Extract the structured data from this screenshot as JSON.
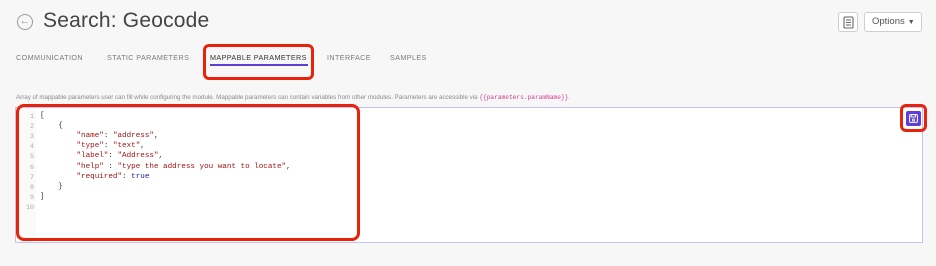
{
  "header": {
    "title": "Search: Geocode",
    "options_label": "Options"
  },
  "tabs": [
    {
      "label": "COMMUNICATION"
    },
    {
      "label": "STATIC PARAMETERS"
    },
    {
      "label": "MAPPABLE PARAMETERS"
    },
    {
      "label": "INTERFACE"
    },
    {
      "label": "SAMPLES"
    }
  ],
  "active_tab": "MAPPABLE PARAMETERS",
  "description": {
    "text": "Array of mappable parameters user can fill while configuring the module. Mappable parameters can contain variables from other modules. Parameters are accessible via ",
    "code_ref": "{{parameters.paramName}}",
    "suffix": "."
  },
  "editor": {
    "line_numbers": [
      "1",
      "2",
      "3",
      "4",
      "5",
      "6",
      "7",
      "8",
      "9",
      "10"
    ],
    "lines": [
      "[",
      "    {",
      "        \"name\": \"address\",",
      "        \"type\": \"text\",",
      "        \"label\": \"Address\",",
      "        \"help\" : \"type the address you want to locate\",",
      "        \"required\": true",
      "    }",
      "]",
      ""
    ]
  },
  "colors": {
    "accent": "#5b3fd6",
    "highlight": "#e8230b"
  },
  "icons": {
    "back": "arrow-left-circle-icon",
    "doc": "document-icon",
    "options_caret": "caret-down-icon",
    "save": "floppy-disk-icon"
  }
}
